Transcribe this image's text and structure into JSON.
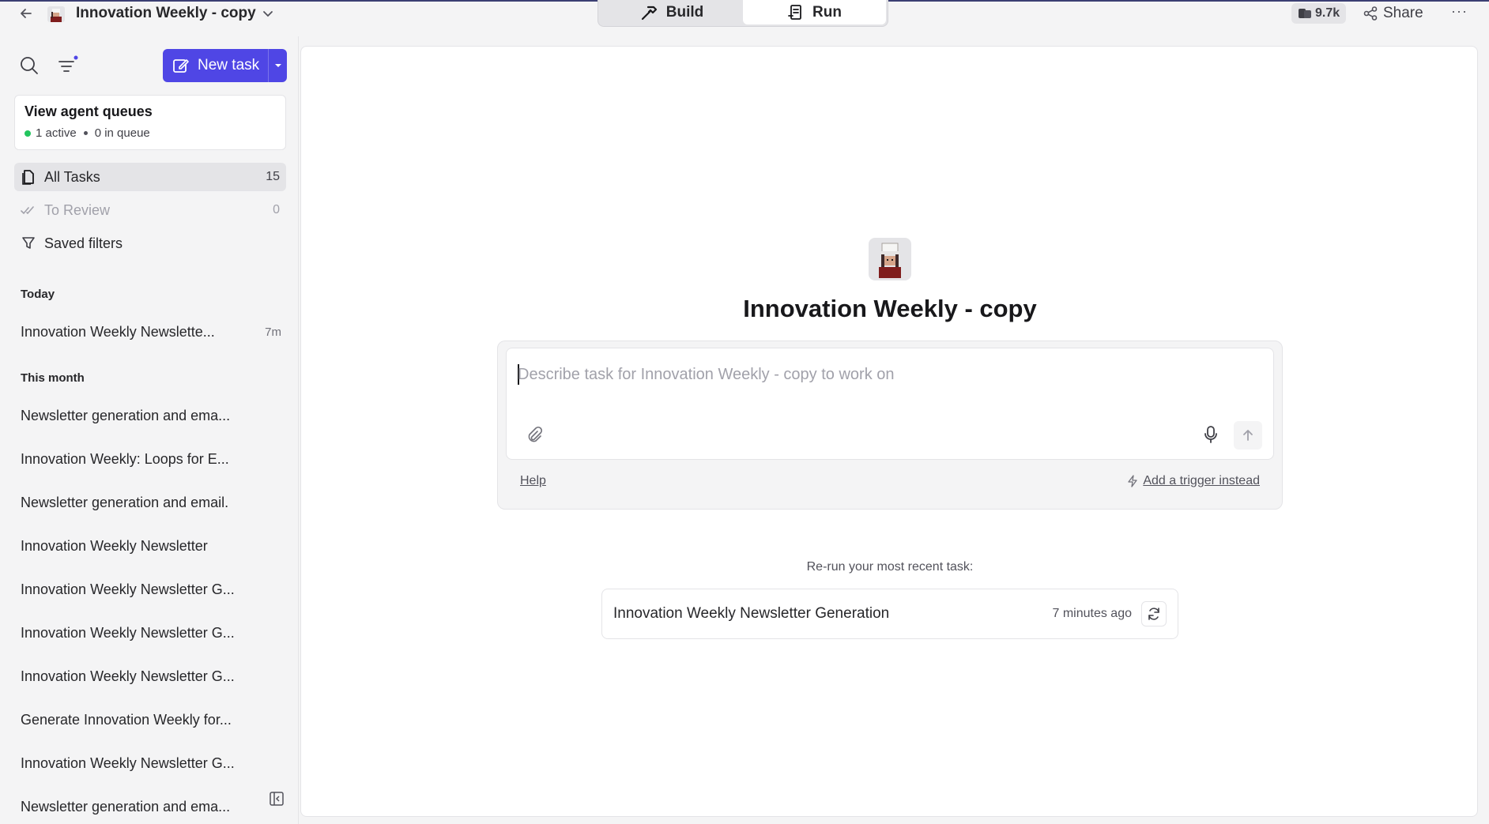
{
  "topbar": {
    "agent_name": "Innovation Weekly - copy",
    "build_label": "Build",
    "run_label": "Run",
    "credits": "9.7k",
    "share_label": "Share",
    "more_label": "···"
  },
  "sidebar": {
    "new_task_label": "New task",
    "queue": {
      "title": "View agent queues",
      "active": "1 active",
      "queued": "0 in queue"
    },
    "nav": {
      "all_tasks": {
        "label": "All Tasks",
        "count": "15"
      },
      "to_review": {
        "label": "To Review",
        "count": "0"
      },
      "saved_filters": {
        "label": "Saved filters"
      }
    },
    "today_heading": "Today",
    "today_tasks": [
      {
        "title": "Innovation Weekly Newslette...",
        "time": "7m"
      }
    ],
    "month_heading": "This month",
    "month_tasks": [
      {
        "title": "Newsletter generation and ema..."
      },
      {
        "title": "Innovation Weekly: Loops for E..."
      },
      {
        "title": "Newsletter generation and email."
      },
      {
        "title": "Innovation Weekly Newsletter"
      },
      {
        "title": "Innovation Weekly Newsletter G..."
      },
      {
        "title": "Innovation Weekly Newsletter G..."
      },
      {
        "title": "Innovation Weekly Newsletter G..."
      },
      {
        "title": "Generate Innovation Weekly for..."
      },
      {
        "title": "Innovation Weekly Newsletter G..."
      },
      {
        "title": "Newsletter generation and ema..."
      }
    ]
  },
  "main": {
    "agent_title": "Innovation Weekly - copy",
    "composer_placeholder": "Describe task for Innovation Weekly - copy to work on",
    "help_label": "Help",
    "trigger_label": "Add a trigger instead",
    "rerun_label": "Re-run your most recent task:",
    "rerun_task": "Innovation Weekly Newsletter Generation",
    "rerun_time": "7 minutes ago"
  },
  "colors": {
    "accent": "#4f46e5",
    "active_dot": "#22c55e",
    "window_border": "#3b3f73"
  }
}
